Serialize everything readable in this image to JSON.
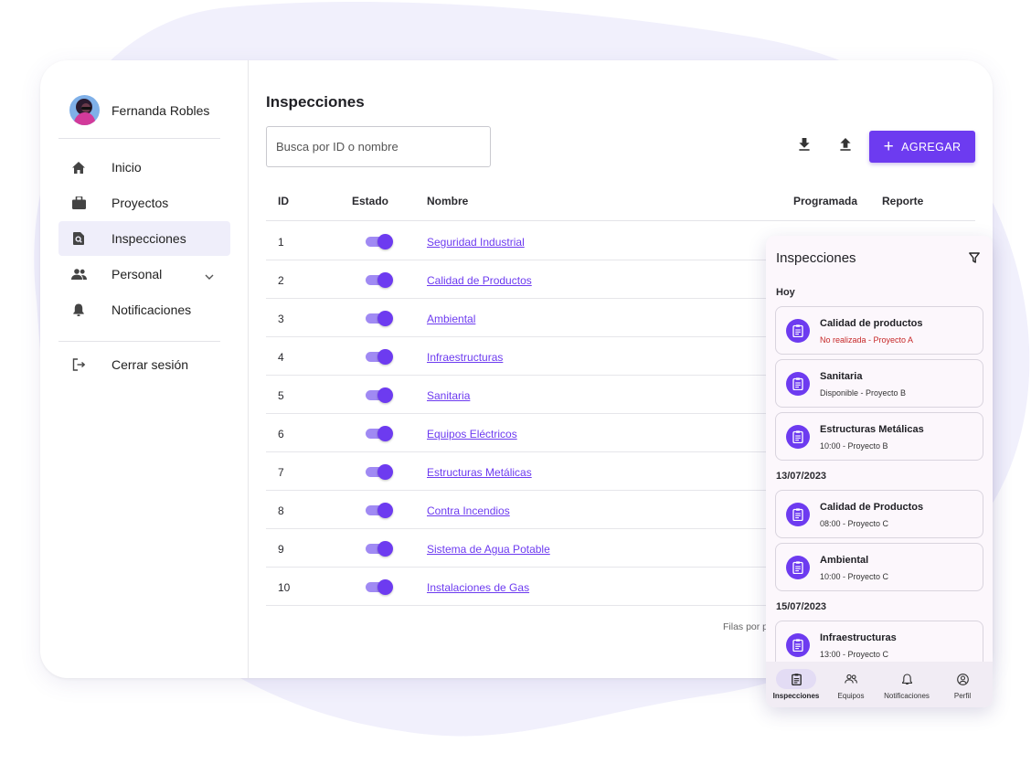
{
  "colors": {
    "accent": "#6d3bf0",
    "accent_light": "#a08af3",
    "blob": "#f1f0fc",
    "error": "#c62828"
  },
  "sidebar": {
    "user_name": "Fernanda Robles",
    "items": [
      {
        "label": "Inicio",
        "icon": "home-icon"
      },
      {
        "label": "Proyectos",
        "icon": "briefcase-icon"
      },
      {
        "label": "Inspecciones",
        "icon": "inspection-search-icon",
        "active": true
      },
      {
        "label": "Personal",
        "icon": "people-icon",
        "expandable": true
      },
      {
        "label": "Notificaciones",
        "icon": "bell-icon"
      }
    ],
    "logout_label": "Cerrar sesión"
  },
  "main": {
    "title": "Inspecciones",
    "search_placeholder": "Busca por ID o nombre",
    "add_label": "AGREGAR",
    "columns": {
      "id": "ID",
      "estado": "Estado",
      "nombre": "Nombre",
      "programada": "Programada",
      "reporte": "Reporte"
    },
    "rows": [
      {
        "id": "1",
        "name": "Seguridad Industrial",
        "active": true
      },
      {
        "id": "2",
        "name": "Calidad de Productos",
        "active": true
      },
      {
        "id": "3",
        "name": "Ambiental",
        "active": true
      },
      {
        "id": "4",
        "name": "Infraestructuras",
        "active": true
      },
      {
        "id": "5",
        "name": "Sanitaria",
        "active": true
      },
      {
        "id": "6",
        "name": "Equipos Eléctricos",
        "active": true
      },
      {
        "id": "7",
        "name": "Estructuras Metálicas",
        "active": true
      },
      {
        "id": "8",
        "name": "Contra Incendios",
        "active": true
      },
      {
        "id": "9",
        "name": "Sistema de Agua Potable",
        "active": true
      },
      {
        "id": "10",
        "name": "Instalaciones de Gas",
        "active": true
      }
    ],
    "footer_text": "Filas por p"
  },
  "mobile": {
    "title": "Inspecciones",
    "sections": [
      {
        "label": "Hoy",
        "cards": [
          {
            "title": "Calidad de productos",
            "subtitle": "No realizada - Proyecto A",
            "alert": true
          },
          {
            "title": "Sanitaria",
            "subtitle": "Disponible - Proyecto B"
          },
          {
            "title": "Estructuras Metálicas",
            "subtitle": "10:00 - Proyecto B"
          }
        ]
      },
      {
        "label": "13/07/2023",
        "cards": [
          {
            "title": "Calidad de Productos",
            "subtitle": "08:00 - Proyecto C"
          },
          {
            "title": "Ambiental",
            "subtitle": "10:00 - Proyecto C"
          }
        ]
      },
      {
        "label": "15/07/2023",
        "cards": [
          {
            "title": "Infraestructuras",
            "subtitle": "13:00 - Proyecto C"
          }
        ]
      }
    ],
    "bottom_nav": [
      {
        "label": "Inspecciones",
        "icon": "clipboard-icon",
        "active": true
      },
      {
        "label": "Equipos",
        "icon": "people-icon"
      },
      {
        "label": "Notificaciones",
        "icon": "bell-outline-icon"
      },
      {
        "label": "Perfil",
        "icon": "profile-icon"
      }
    ]
  }
}
